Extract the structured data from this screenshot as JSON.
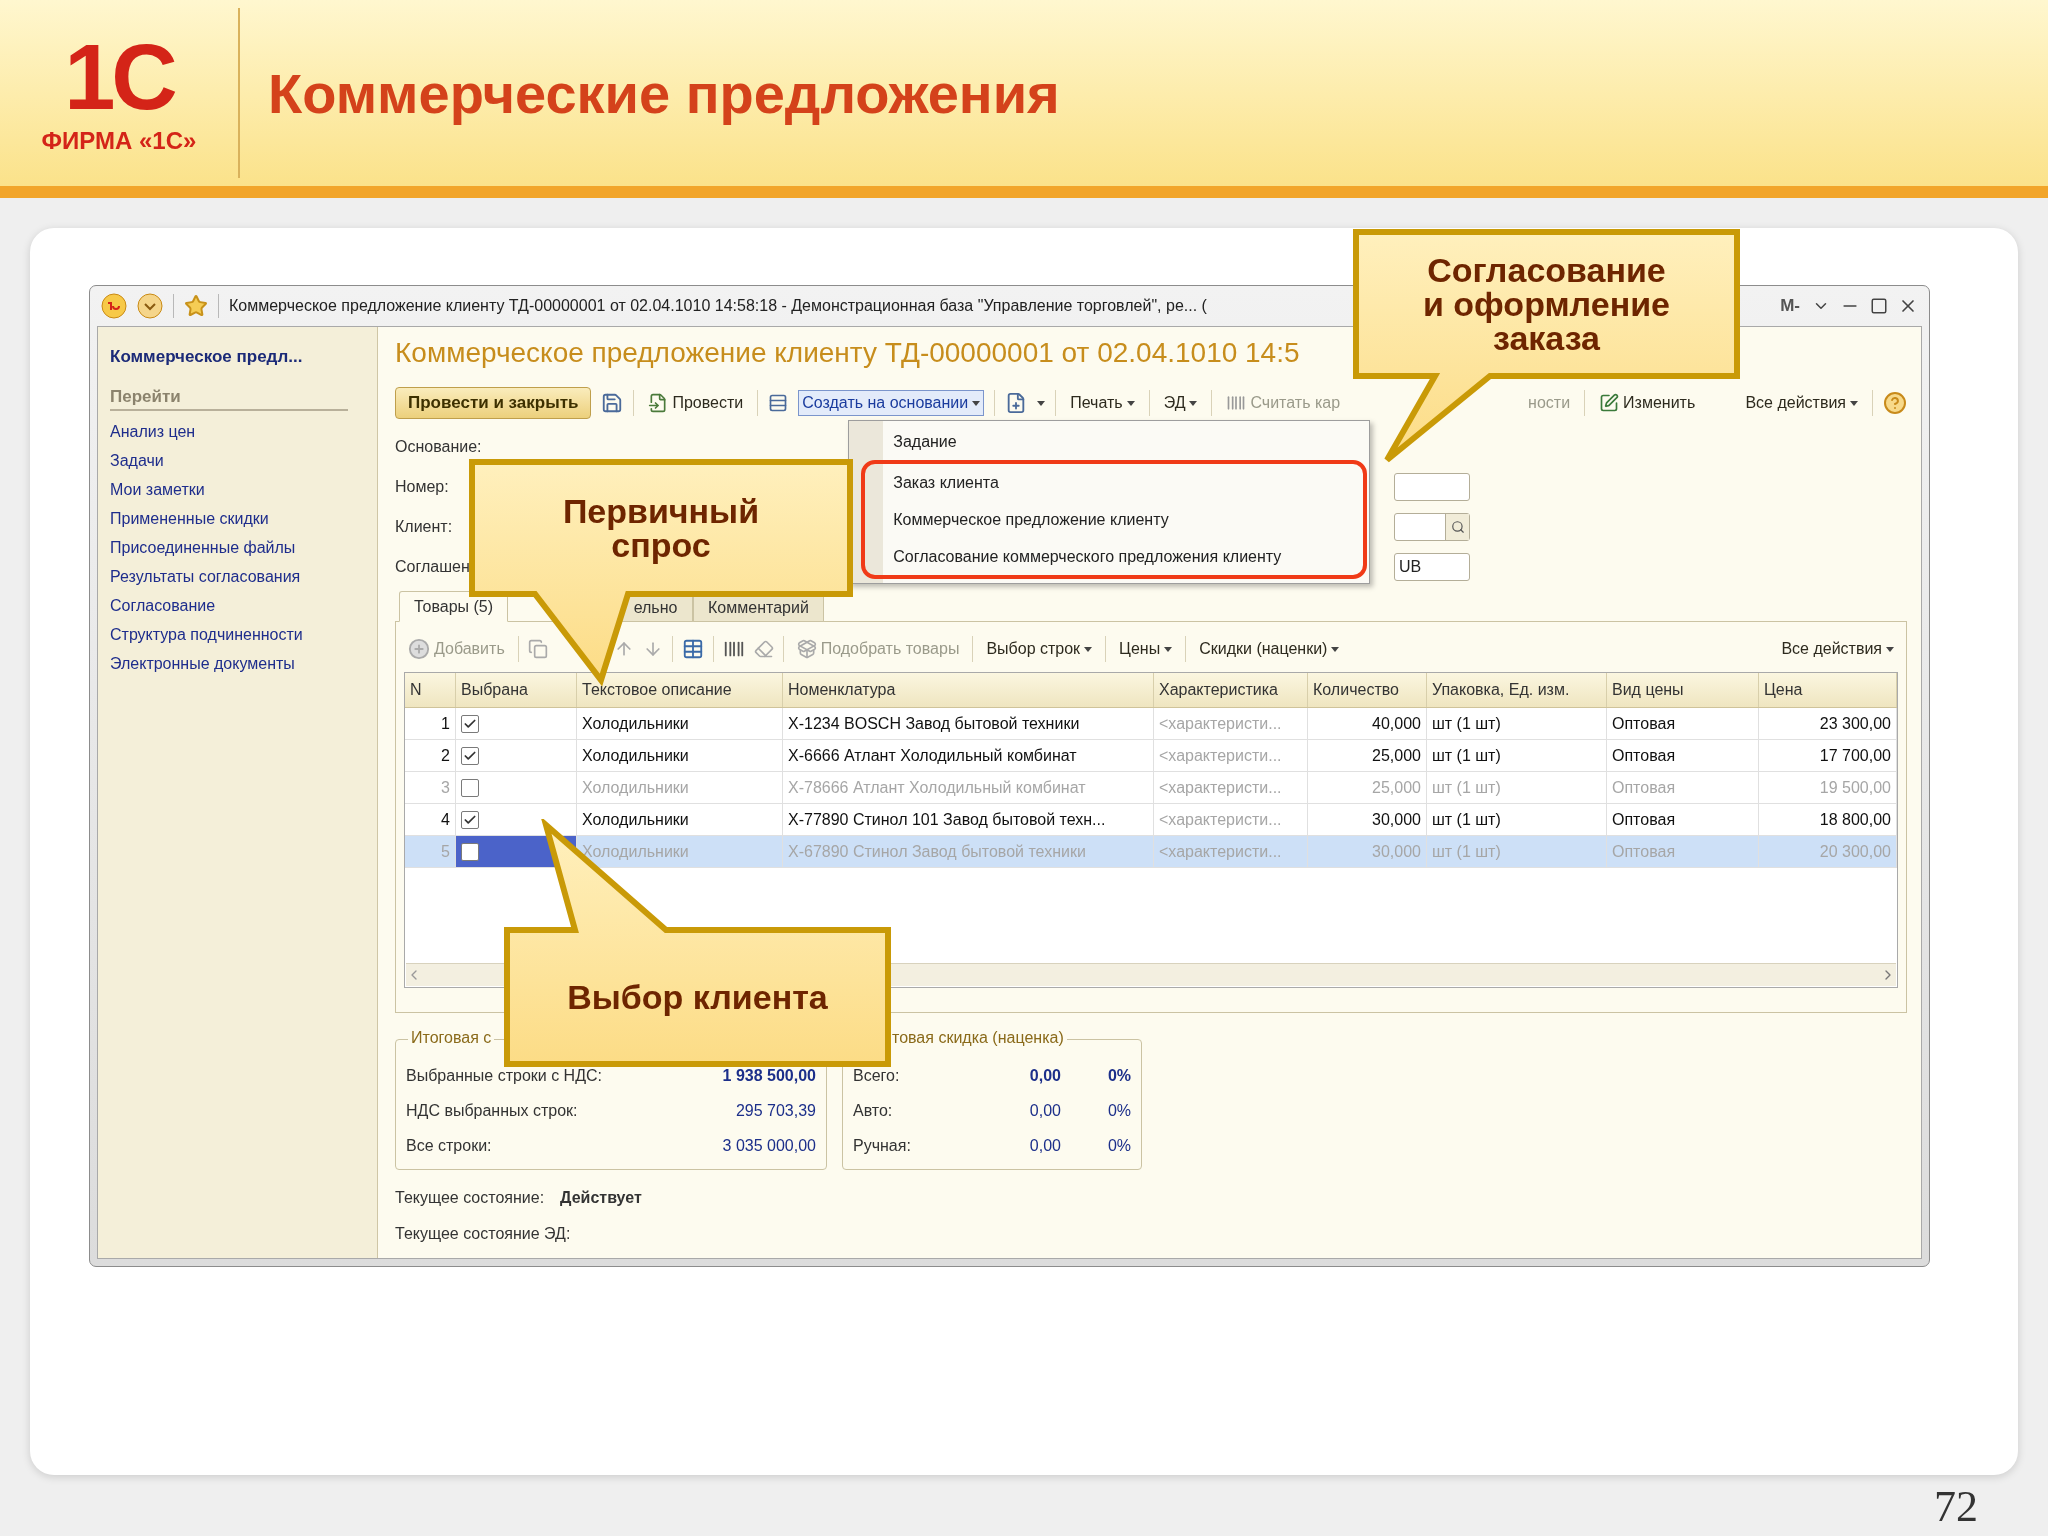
{
  "slide": {
    "logo_mark": "1С",
    "logo_caption": "ФИРМА «1С»",
    "title": "Коммерческие предложения",
    "page_number": "72"
  },
  "window": {
    "title": "Коммерческое предложение клиенту ТД-00000001 от 02.04.1010 14:58:18 - Демонстрационная база \"Управление торговлей\", ре... (",
    "memory_button": "M-"
  },
  "sidebar": {
    "heading": "Коммерческое предл...",
    "section": "Перейти",
    "items": [
      "Анализ цен",
      "Задачи",
      "Мои заметки",
      "Примененные скидки",
      "Присоединенные файлы",
      "Результаты согласования",
      "Согласование",
      "Структура подчиненности",
      "Электронные документы"
    ]
  },
  "document": {
    "title": "Коммерческое предложение клиенту ТД-00000001 от 02.04.1010 14:5",
    "toolbar": {
      "post_close": "Провести и закрыть",
      "post": "Провести",
      "create_based": "Создать на основании",
      "print": "Печать",
      "ed": "ЭД",
      "scan": "Считать кар",
      "scan_tail": "ности",
      "edit": "Изменить",
      "all_actions": "Все действия"
    },
    "create_menu": {
      "expanded": true,
      "items": [
        {
          "label": "Задание",
          "marked": false
        },
        {
          "label": "Заказ клиента",
          "marked": true
        },
        {
          "label": "Коммерческое предложение клиенту",
          "marked": true
        },
        {
          "label": "Согласование коммерческого предложения клиенту",
          "marked": true
        }
      ]
    },
    "fields": [
      {
        "label": "Основание:",
        "kind": "none"
      },
      {
        "label": "Номер:",
        "kind": "text"
      },
      {
        "label": "Клиент:",
        "kind": "lookup"
      },
      {
        "label": "Соглашен",
        "kind": "text",
        "value": "UB"
      }
    ],
    "tabs": [
      {
        "label": "Товары (5)",
        "selected": true
      },
      {
        "label": "ельно",
        "selected": false
      },
      {
        "label": "Комментарий",
        "selected": false
      }
    ],
    "table_toolbar": {
      "add": "Добавить",
      "pick": "Подобрать товары",
      "row_select": "Выбор строк",
      "prices": "Цены",
      "discounts": "Скидки (наценки)",
      "all_actions": "Все действия"
    },
    "table": {
      "columns": [
        "N",
        "Выбрана",
        "Текстовое описание",
        "Номенклатура",
        "Характеристика",
        "Количество",
        "Упаковка, Ед. изм.",
        "Вид цены",
        "Цена"
      ],
      "rows": [
        {
          "n": "1",
          "checked": true,
          "selected": false,
          "description": "Холодильники",
          "item": "X-1234 BOSCH Завод бытовой техники",
          "characteristic": "<характеристи...",
          "quantity": "40,000",
          "unit": "шт (1 шт)",
          "price_type": "Оптовая",
          "price": "23 300,00"
        },
        {
          "n": "2",
          "checked": true,
          "selected": false,
          "description": "Холодильники",
          "item": "X-6666 Атлант Холодильный комбинат",
          "characteristic": "<характеристи...",
          "quantity": "25,000",
          "unit": "шт (1 шт)",
          "price_type": "Оптовая",
          "price": "17 700,00"
        },
        {
          "n": "3",
          "checked": false,
          "selected": false,
          "description": "Холодильники",
          "item": "X-78666 Атлант Холодильный комбинат",
          "characteristic": "<характеристи...",
          "quantity": "25,000",
          "unit": "шт (1 шт)",
          "price_type": "Оптовая",
          "price": "19 500,00"
        },
        {
          "n": "4",
          "checked": true,
          "selected": false,
          "description": "Холодильники",
          "item": "X-77890 Стинол 101 Завод бытовой техн...",
          "characteristic": "<характеристи...",
          "quantity": "30,000",
          "unit": "шт (1 шт)",
          "price_type": "Оптовая",
          "price": "18 800,00"
        },
        {
          "n": "5",
          "checked": false,
          "selected": true,
          "description": "Холодильники",
          "item": "X-67890 Стинол Завод бытовой техники",
          "characteristic": "<характеристи...",
          "quantity": "30,000",
          "unit": "шт (1 шт)",
          "price_type": "Оптовая",
          "price": "20 300,00"
        }
      ]
    },
    "totals": {
      "title": "Итоговая с",
      "rows": [
        {
          "label": "Выбранные строки с НДС:",
          "value": "1 938 500,00",
          "emphasis": true
        },
        {
          "label": "НДС выбранных строк:",
          "value": "295 703,39",
          "emphasis": false
        },
        {
          "label": "Все строки:",
          "value": "3 035 000,00",
          "emphasis": false
        }
      ]
    },
    "discount": {
      "title": "товая скидка (наценка)",
      "rows": [
        {
          "label": "Всего:",
          "value": "0,00",
          "percent": "0%",
          "emphasis": true
        },
        {
          "label": "Авто:",
          "value": "0,00",
          "percent": "0%",
          "emphasis": false
        },
        {
          "label": "Ручная:",
          "value": "0,00",
          "percent": "0%",
          "emphasis": false
        }
      ]
    },
    "status": [
      {
        "label": "Текущее состояние:",
        "value": "Действует"
      },
      {
        "label": "Текущее состояние ЭД:"
      }
    ]
  },
  "callouts": [
    {
      "lines": [
        "Согласование",
        "и оформление",
        "заказа"
      ]
    },
    {
      "lines": [
        "Первичный",
        "спрос"
      ]
    },
    {
      "lines": [
        "Выбор клиента"
      ]
    }
  ]
}
